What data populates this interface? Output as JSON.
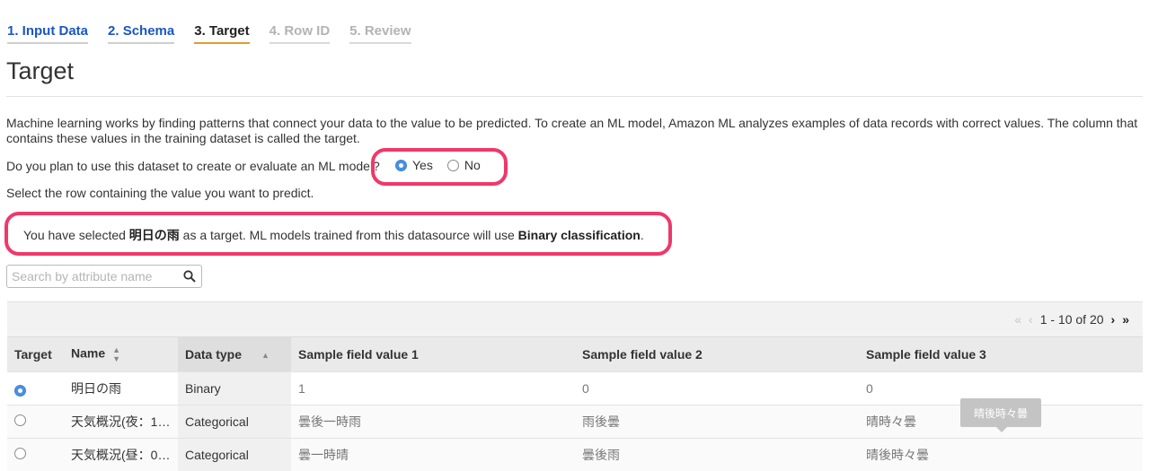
{
  "wizard": {
    "steps": [
      {
        "label": "1. Input Data",
        "state": "done"
      },
      {
        "label": "2. Schema",
        "state": "done"
      },
      {
        "label": "3. Target",
        "state": "active"
      },
      {
        "label": "4. Row ID",
        "state": "disabled"
      },
      {
        "label": "5. Review",
        "state": "disabled"
      }
    ]
  },
  "page": {
    "title": "Target",
    "description": "Machine learning works by finding patterns that connect your data to the value to be predicted. To create an ML model, Amazon ML analyzes examples of data records with correct values. The column that contains these values in the training dataset is called the target.",
    "question": "Do you plan to use this dataset to create or evaluate an ML model?",
    "options": {
      "yes": "Yes",
      "no": "No",
      "selected": "Yes"
    },
    "select_prompt": "Select the row containing the value you want to predict."
  },
  "info": {
    "prefix": "You have selected ",
    "target": "明日の雨",
    "middle": " as a target. ML models trained from this datasource will use ",
    "model_type": "Binary classification",
    "suffix": "."
  },
  "search": {
    "placeholder": "Search by attribute name"
  },
  "pager": {
    "first": "«",
    "prev": "‹",
    "range": "1 - 10 of 20",
    "next": "›",
    "last": "»"
  },
  "table": {
    "headers": {
      "target": "Target",
      "name": "Name",
      "type": "Data type",
      "s1": "Sample field value 1",
      "s2": "Sample field value 2",
      "s3": "Sample field value 3"
    },
    "rows": [
      {
        "selected": true,
        "name": "明日の雨",
        "type": "Binary",
        "s1": "1",
        "s2": "0",
        "s3": "0"
      },
      {
        "selected": false,
        "name": "天気概況(夜：1…",
        "type": "Categorical",
        "s1": "曇後一時雨",
        "s2": "雨後曇",
        "s3": "晴時々曇"
      },
      {
        "selected": false,
        "name": "天気概況(昼：0…",
        "type": "Categorical",
        "s1": "曇一時晴",
        "s2": "曇後雨",
        "s3": "晴後時々曇"
      }
    ]
  },
  "tooltip": {
    "text": "晴後時々曇"
  },
  "colors": {
    "link": "#1a56c6",
    "active_underline": "#e49b2c",
    "highlight": "#f0386b",
    "radio_checked": "#4a90e2"
  }
}
